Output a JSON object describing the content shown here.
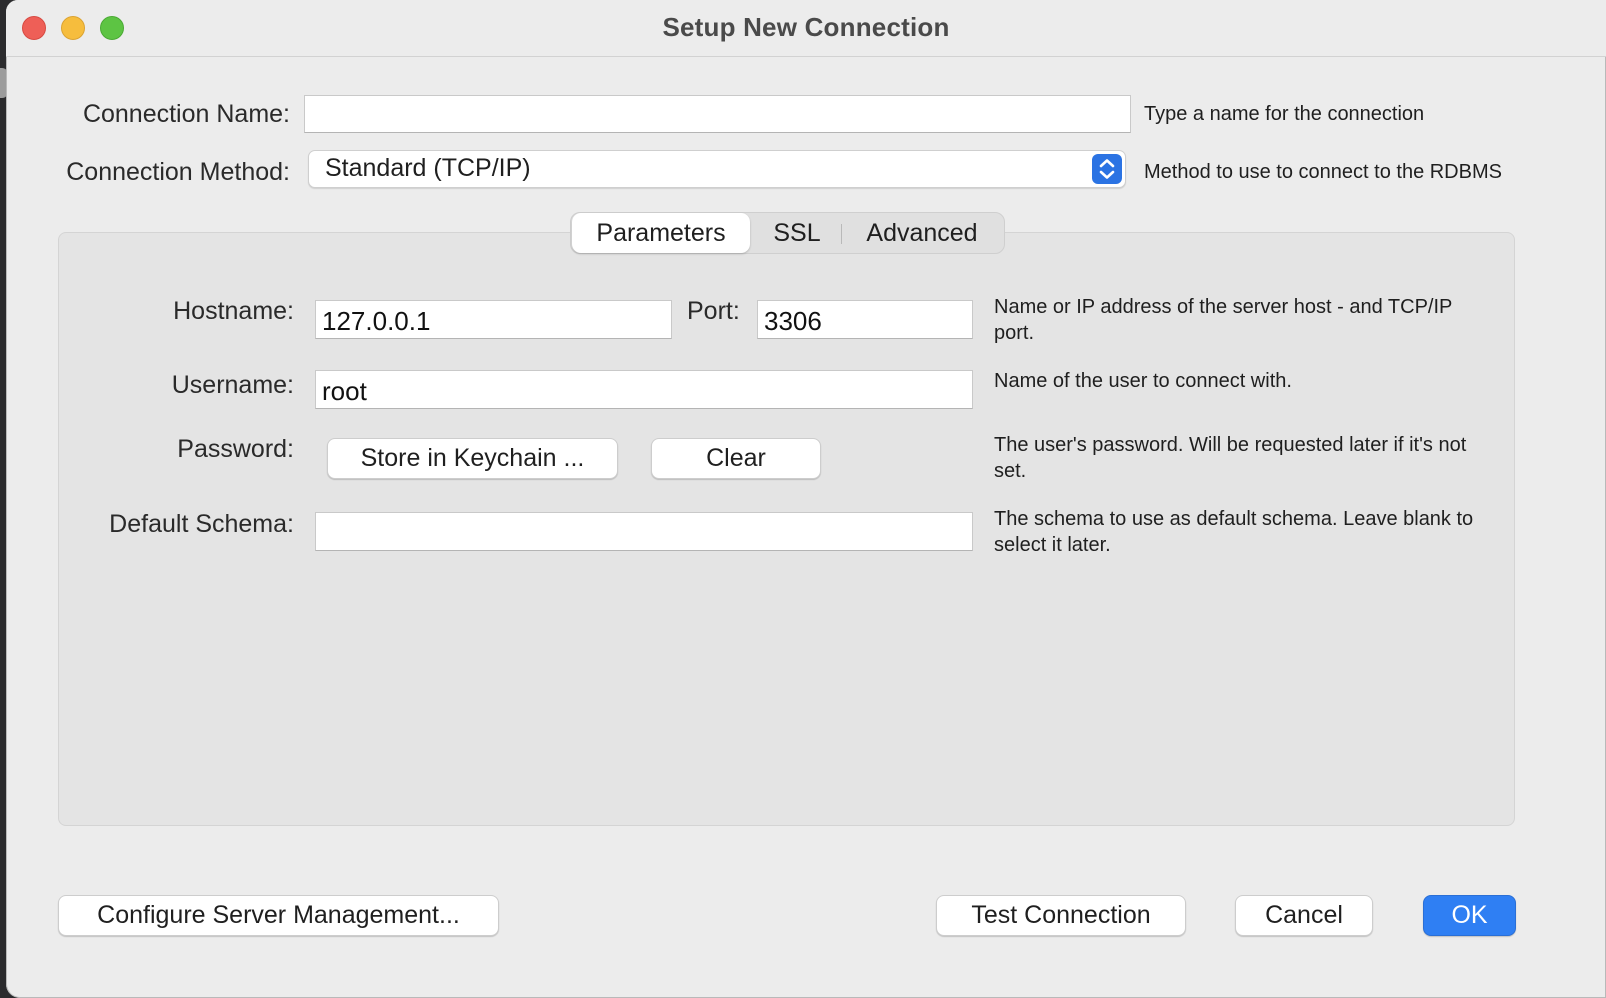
{
  "window": {
    "title": "Setup New Connection"
  },
  "form": {
    "connection_name_label": "Connection Name:",
    "connection_name_value": "",
    "connection_name_hint": "Type a name for the connection",
    "connection_method_label": "Connection Method:",
    "connection_method_value": "Standard (TCP/IP)",
    "connection_method_hint": "Method to use to connect to the RDBMS"
  },
  "tabs": [
    {
      "label": "Parameters",
      "active": true
    },
    {
      "label": "SSL",
      "active": false
    },
    {
      "label": "Advanced",
      "active": false
    }
  ],
  "parameters": {
    "hostname_label": "Hostname:",
    "hostname_value": "127.0.0.1",
    "port_label": "Port:",
    "port_value": "3306",
    "host_hint": "Name or IP address of the server host - and TCP/IP port.",
    "username_label": "Username:",
    "username_value": "root",
    "username_hint": "Name of the user to connect with.",
    "password_label": "Password:",
    "store_keychain_label": "Store in Keychain ...",
    "clear_label": "Clear",
    "password_hint": "The user's password. Will be requested later if it's not set.",
    "default_schema_label": "Default Schema:",
    "default_schema_value": "",
    "default_schema_hint": "The schema to use as default schema. Leave blank to select it later."
  },
  "footer": {
    "configure_label": "Configure Server Management...",
    "test_label": "Test Connection",
    "cancel_label": "Cancel",
    "ok_label": "OK"
  },
  "colors": {
    "accent": "#2f7ff3",
    "close": "#ee5f57",
    "minimize": "#f6bd3d",
    "maximize": "#5dc443"
  }
}
